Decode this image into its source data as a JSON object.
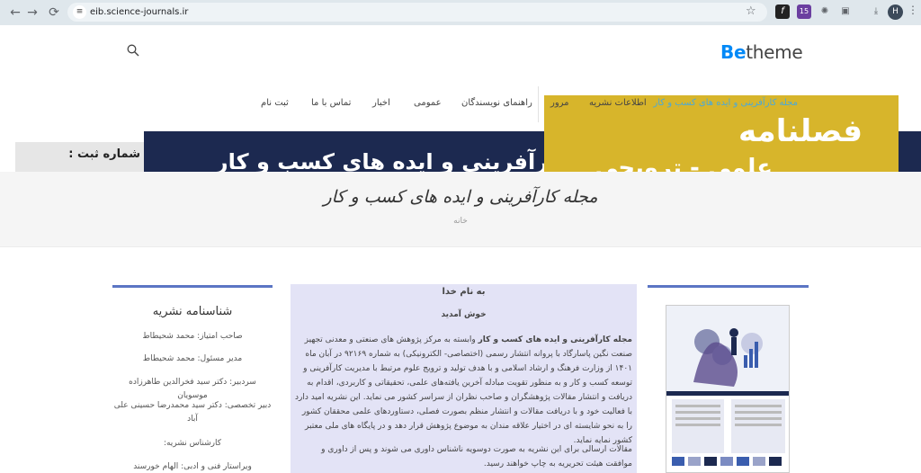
{
  "browser": {
    "url": "eib.science-journals.ir",
    "back_icon": "←",
    "forward_icon": "→",
    "reload_icon": "⟳",
    "star_icon": "☆",
    "ext_badge": "15",
    "avatar_letter": "H",
    "more_icon": "⋮"
  },
  "header": {
    "logo_be": "Be",
    "logo_rest": "theme"
  },
  "nav": {
    "journal": "مجله کارآفرینی و ایده های کسب و کار",
    "about": "اطلاعات نشریه",
    "browse": "مرور",
    "guide": "راهنمای نویسندگان",
    "general": "عمومی",
    "news": "اخبار",
    "contact": "تماس با ما",
    "register": "ثبت نام"
  },
  "banner": {
    "dark_text": "کارآفرینی و ایده های کسب و کار",
    "yellow_big": "فصلنامه",
    "yellow_low": "علمی - ترویجی",
    "reg_label": "شماره ثبت :"
  },
  "page": {
    "title": "مجله کارآفرینی و ایده های کسب و کار",
    "breadcrumb": "خانه"
  },
  "main": {
    "basmala": "به نام خدا",
    "welcome": "خوش آمدید",
    "journal_bold": "مجله کارآفرینی و ایده های کسب و کار",
    "para1_rest": " وابسته به مرکز پژوهش های صنعتی و معدنی تجهیز صنعت نگین پاسارگاد با پروانه انتشار رسمی (اختصاصی- الکترونیکی) به شماره ۹۲۱۶۹ در آبان ماه ۱۴۰۱ از وزارت فرهنگ و ارشاد اسلامی و با هدف تولید و ترویج علوم مرتبط با مدیریت کارآفرینی و توسعه کسب و کار و به منظور تقویت مبادله آخرین یافته‌های علمی، تحقیقاتی و کاربردی، اقدام به دریافت و انتشار مقالات پژوهشگران و صاحب نظران از سراسر کشور می نماید. این نشریه امید دارد با فعالیت خود و با دریافت مقالات و انتشار منظم بصورت فصلی، دستاوردهای علمی  محققان کشور را به نحو شایسته ای در اختیار علاقه مندان به موضوع پژوهش قرار دهد و در پایگاه های ملی معتبر کشور نمایه نماید.",
    "para2": "مقالات ارسالی برای این نشریه به صورت دوسویه ناشناس داوری می شوند و پس از داوری و موافقت هیئت تحریریه به چاپ خواهند رسید."
  },
  "sidebar": {
    "title": "شناسنامه نشریه",
    "items": [
      "صاحب امتیاز: محمد شحیطاط",
      "مدیر مسئول: محمد شحیطاط",
      "سردبیر: دکتر سید فخرالدین طاهرزاده موسویان",
      "دبیر تخصصی: دکتر سید محمدرضا حسینی علی آباد",
      "کارشناس نشریه:",
      "ویراستار فنی و ادبی: الهام خورسند"
    ]
  },
  "colors": {
    "accent_blue": "#0089f7",
    "nav_highlight": "#4aa9d9",
    "banner_dark": "#1c2950",
    "banner_yellow": "#d7b52b",
    "column_bar": "#5b75c4"
  }
}
